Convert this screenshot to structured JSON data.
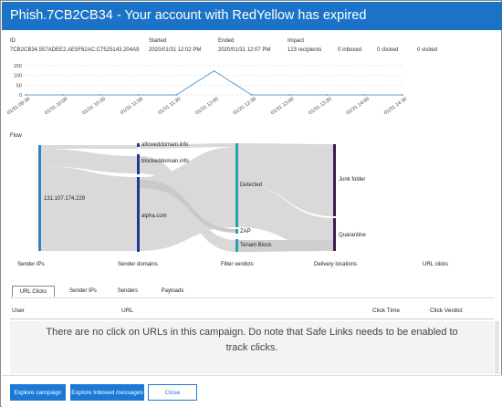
{
  "window": {
    "title": "Phish.7CB2CB34 - Your account with RedYellow has expired"
  },
  "summary": {
    "id_label": "ID",
    "id_value": "7CB2CB34.557ADEE2.AE5F82AC.C7525143.204A9",
    "started_label": "Started",
    "started_value": "2020/01/31 12:02 PM",
    "ended_label": "Ended",
    "ended_value": "2020/01/31 12:07 PM",
    "impact_label": "Impact",
    "recipients": "123 recipients",
    "inboxed": "0 inboxed",
    "clicked": "0 clicked",
    "visited": "0 visited"
  },
  "chart_data": {
    "type": "line",
    "x": [
      "01/31 09:30",
      "01/31 10:00",
      "01/31 10:30",
      "01/31 11:00",
      "01/31 11:30",
      "01/31 12:00",
      "01/31 12:30",
      "01/31 13:00",
      "01/31 13:30",
      "01/31 14:00",
      "01/31 14:30"
    ],
    "values": [
      0,
      0,
      0,
      0,
      0,
      123,
      0,
      0,
      0,
      0,
      0
    ],
    "yticks": [
      "150",
      "100",
      "50",
      "0"
    ],
    "ylim": [
      0,
      150
    ],
    "grid": true,
    "color": "#5b9bd5"
  },
  "flow": {
    "label": "Flow",
    "nodes": {
      "sender_ip": "131.107.174.229",
      "allowed_domain": "alloweddomain.info",
      "blocked_domain": "blockeddomain.info",
      "alpha_domain": "alpha.com",
      "detected": "Detected",
      "zap": "ZAP",
      "tenant_block": "Tenant Block",
      "junk_folder": "Junk folder",
      "quarantine": "Quarantine"
    },
    "columns": [
      "Sender IPs",
      "Sender domains",
      "Filter verdicts",
      "Delivery locations",
      "URL clicks"
    ],
    "colors": {
      "ip": "#2e86c1",
      "domain": "#1f3a93",
      "verdict": "#27a3b0",
      "delivery": "#3d1a4f",
      "band": "#d9d9d9"
    }
  },
  "tabs": [
    {
      "label": "URL Clicks",
      "active": true
    },
    {
      "label": "Sender IPs",
      "active": false
    },
    {
      "label": "Senders",
      "active": false
    },
    {
      "label": "Payloads",
      "active": false
    }
  ],
  "table": {
    "columns": [
      "User",
      "URL",
      "Click Time",
      "Click Verdict"
    ],
    "empty_message": "There are no click on URLs in this campaign. Do note that Safe Links needs to be enabled to track clicks."
  },
  "footer": {
    "explore_campaign": "Explore campaign",
    "explore_inboxed": "Explore Inboxed messages",
    "close": "Close"
  }
}
